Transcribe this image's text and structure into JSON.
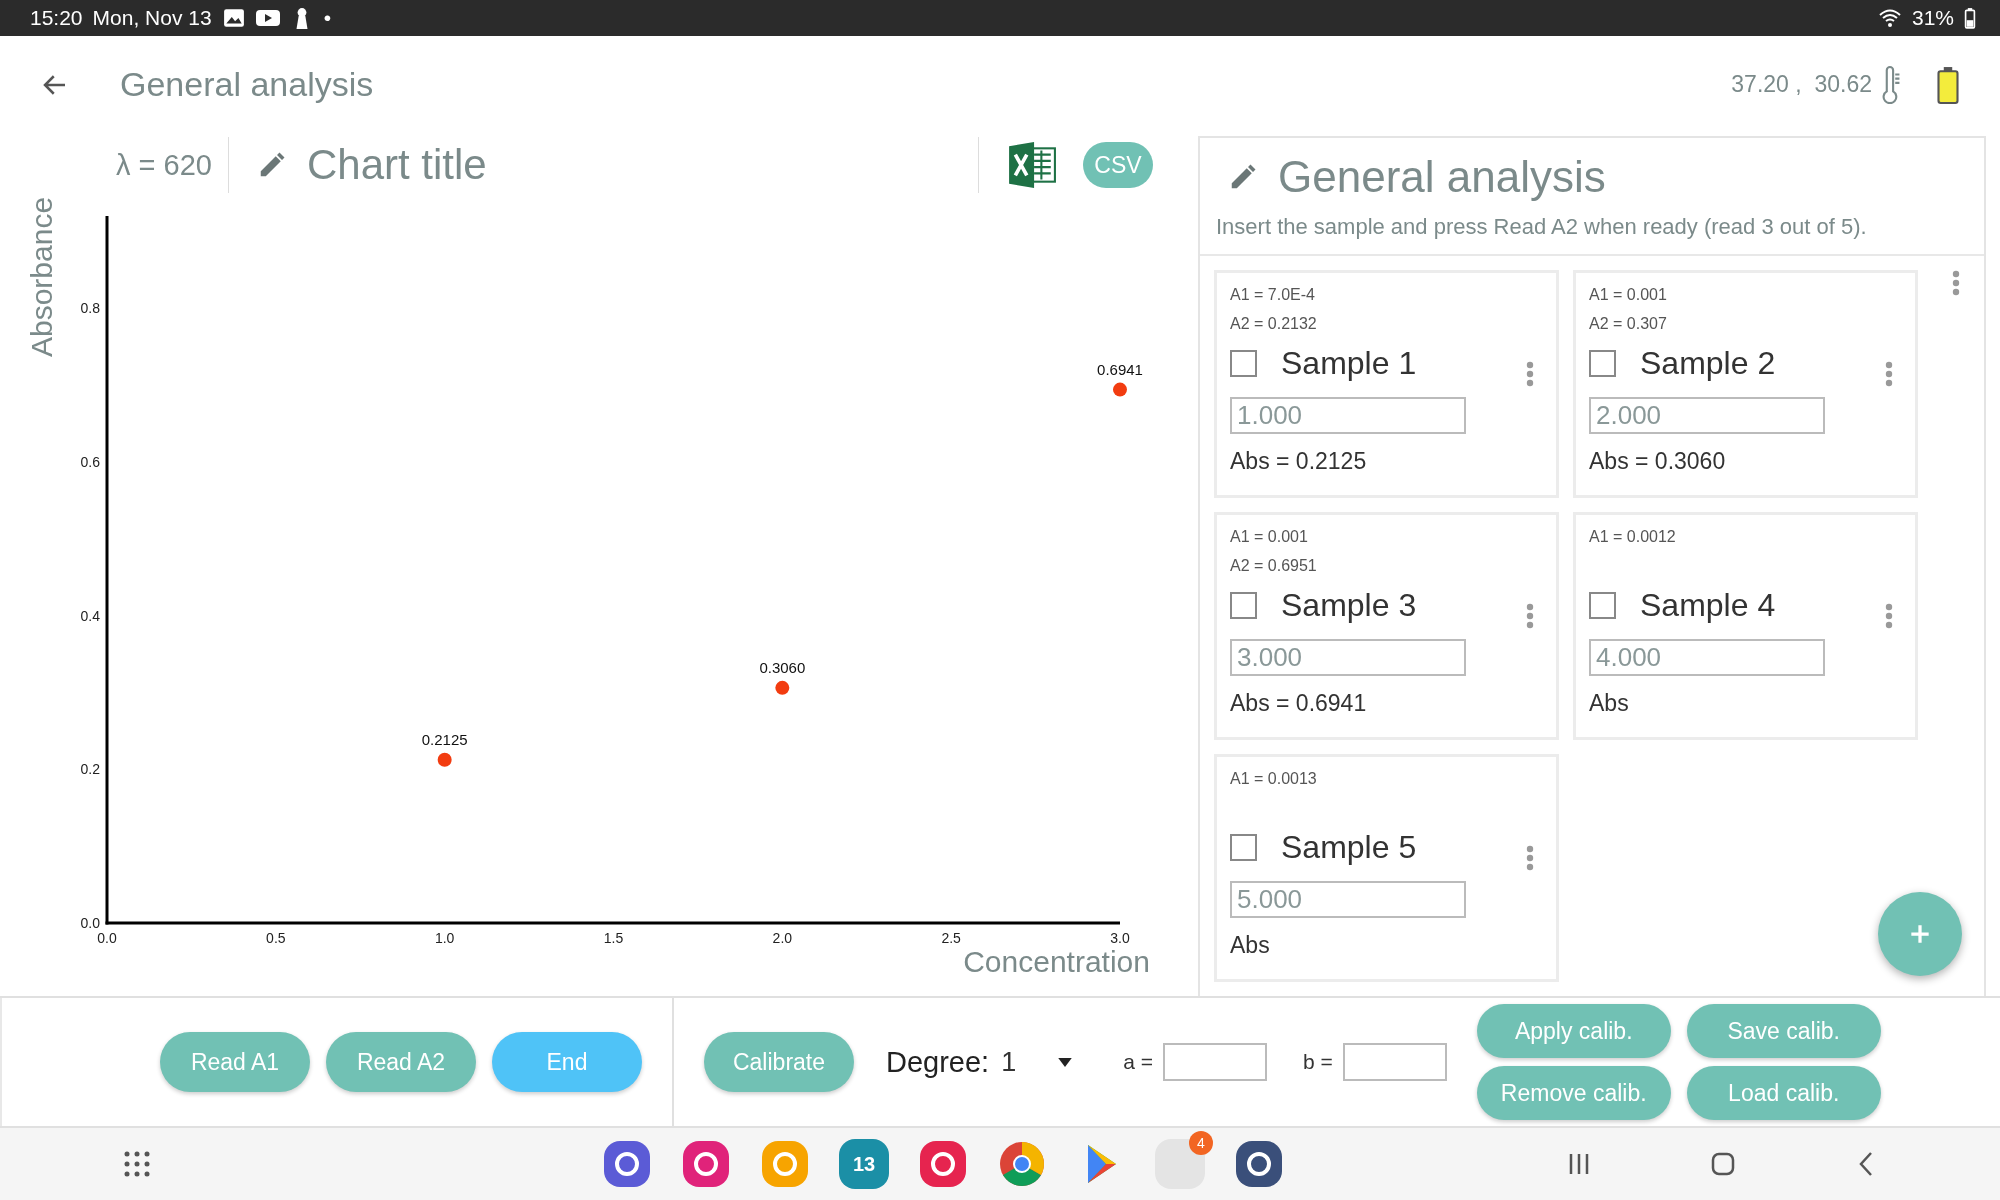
{
  "status_bar": {
    "time": "15:20",
    "date": "Mon, Nov 13",
    "notification_dot": "•",
    "battery": "31%"
  },
  "header": {
    "title": "General analysis",
    "readings": "37.20 ,  30.62"
  },
  "chart_toolbar": {
    "wavelength": "λ = 620",
    "title": "Chart title",
    "export_button": "CSV"
  },
  "chart": {
    "chart_data": {
      "type": "scatter",
      "xlabel": "Concentration",
      "ylabel": "Absorbance",
      "x": [
        1,
        2,
        3
      ],
      "series": [
        {
          "color": "#f23c10",
          "values": [
            0.2125,
            0.306,
            0.6941
          ]
        }
      ],
      "xlim": [
        0,
        3
      ],
      "ylim": [
        0,
        0.92
      ],
      "xticks": [
        {
          "value": 0,
          "label": "0.0"
        },
        {
          "value": 0.5,
          "label": "0.5"
        },
        {
          "value": 1,
          "label": "1.0"
        },
        {
          "value": 1.5,
          "label": "1.5"
        },
        {
          "value": 2,
          "label": "2.0"
        },
        {
          "value": 2.5,
          "label": "2.5"
        },
        {
          "value": 3,
          "label": "3.0"
        }
      ],
      "yticks": [
        {
          "value": 0,
          "label": "0.0"
        },
        {
          "value": 0.2,
          "label": "0.2"
        },
        {
          "value": 0.4,
          "label": "0.4"
        },
        {
          "value": 0.6,
          "label": "0.6"
        },
        {
          "value": 0.8,
          "label": "0.8"
        }
      ],
      "value_labels": [
        "0.2125",
        "0.3060",
        "0.6941"
      ]
    }
  },
  "panel": {
    "title": "General analysis",
    "instructions": "Insert the sample and press Read A2 when ready (read 3 out of 5).",
    "samples": [
      {
        "a1": "A1 = 7.0E-4",
        "a2": "A2 = 0.2132",
        "name": "Sample 1",
        "checked": false,
        "concentration": "1.000",
        "abs": "Abs = 0.2125"
      },
      {
        "a1": "A1 = 0.001",
        "a2": "A2 = 0.307",
        "name": "Sample 2",
        "checked": false,
        "concentration": "2.000",
        "abs": "Abs = 0.3060"
      },
      {
        "a1": "A1 = 0.001",
        "a2": "A2 = 0.6951",
        "name": "Sample 3",
        "checked": false,
        "concentration": "3.000",
        "abs": "Abs = 0.6941"
      },
      {
        "a1": "A1 = 0.0012",
        "name": "Sample 4",
        "checked": false,
        "concentration": "4.000",
        "abs": "Abs"
      },
      {
        "a1": "A1 = 0.0013",
        "name": "Sample 5",
        "checked": false,
        "concentration": "5.000",
        "abs": "Abs"
      }
    ]
  },
  "controls": {
    "read_buttons": [
      {
        "label": "Read A1",
        "kind": "normal"
      },
      {
        "label": "Read A2",
        "kind": "normal"
      },
      {
        "label": "End",
        "kind": "primary"
      }
    ],
    "calibrate": "Calibrate",
    "degree_label": "Degree:",
    "degree_value": "1",
    "a_label": "a =",
    "b_label": "b =",
    "calib_buttons": [
      "Apply calib.",
      "Save calib.",
      "Remove calib.",
      "Load calib."
    ]
  },
  "nav_bar": {
    "calendar_day": "13",
    "app_badge": "4"
  }
}
